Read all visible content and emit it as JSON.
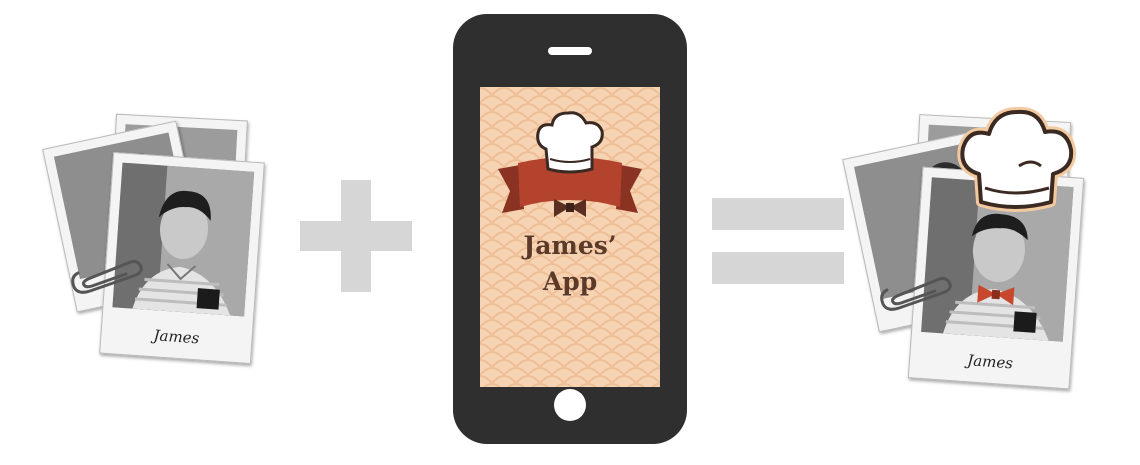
{
  "left_photos": {
    "caption": "James"
  },
  "phone": {
    "app_name_line1": "James’",
    "app_name_line2": "App"
  },
  "right_photos": {
    "caption": "James"
  },
  "colors": {
    "operator_gray": "#d6d6d6",
    "phone_body": "#2f2f2f",
    "screen_bg": "#f6d3b3",
    "ribbon_red": "#b4432d",
    "ribbon_dark": "#8a3322",
    "bowtie": "#6b3a2a",
    "bowtie_red": "#c8482e",
    "title_brown": "#5b3a2a",
    "hat_outline": "#3a2a22",
    "hat_glow": "#f3c9a0"
  }
}
